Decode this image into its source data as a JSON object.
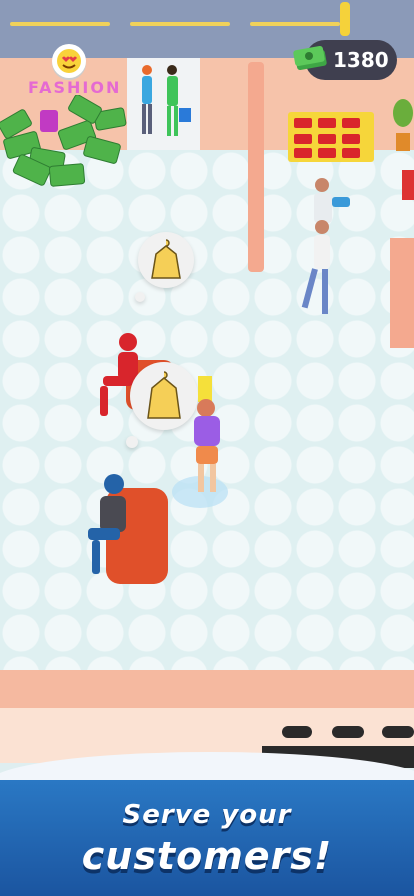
{
  "hud": {
    "money_value": "1380",
    "cash_icon": "cash-stack-icon"
  },
  "store": {
    "sign_label": "FASHION",
    "sign_icon": "heart-eyes-icon"
  },
  "banner": {
    "line1": "Serve your",
    "line2": "customers!"
  },
  "requests": [
    {
      "icon": "yellow-dress-icon"
    },
    {
      "icon": "yellow-dress-icon"
    }
  ],
  "colors": {
    "floor": "#dff0f1",
    "wall": "#f6c3aa",
    "banner": "#1f63b0",
    "money_pill": "#3f3f4f"
  }
}
